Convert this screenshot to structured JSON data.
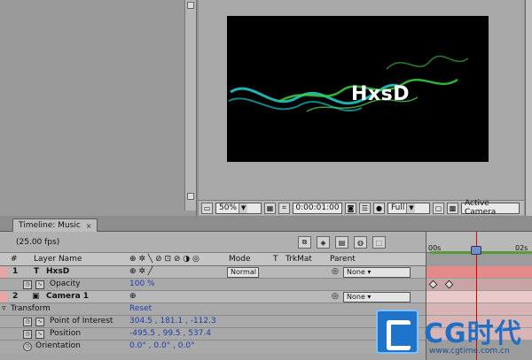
{
  "composition": {
    "text": "HxsD",
    "zoom": "50%",
    "timecode": "0:00:01:00",
    "resolution": "Full",
    "camera": "Active Camera"
  },
  "timeline": {
    "tab_label": "Timeline: Music",
    "tab_close": "×",
    "fps": "(25.00 fps)",
    "columns": {
      "num": "#",
      "layer_name": "Layer Name",
      "mode": "Mode",
      "t": "T",
      "trkmat": "TrkMat",
      "parent": "Parent"
    },
    "rows": [
      {
        "num": "1",
        "type_icon": "T",
        "name": "HxsD",
        "mode": "Normal",
        "parent": "None"
      },
      {
        "prop": "Opacity",
        "value": "100 %"
      },
      {
        "num": "2",
        "name": "Camera 1",
        "parent": "None"
      },
      {
        "section": "Transform",
        "value": "Reset"
      },
      {
        "prop": "Point of Interest",
        "value": "304.5 , 181.1 , -112.3"
      },
      {
        "prop": "Position",
        "value": "-495.5 , 99.5 , 537.4"
      },
      {
        "prop": "Orientation",
        "value": "0.0° , 0.0° , 0.0°"
      }
    ],
    "ruler": {
      "start": "00s",
      "end": "02s"
    }
  },
  "watermark": {
    "brand": "CG时代",
    "url": "www.cgtime.com.cn"
  },
  "colors": {
    "layer1_label": "#e9a5a5",
    "layer2_label": "#e9a5a5",
    "bar_layer1": "#e58a8a",
    "bar_layer2": "#e8c8c8",
    "value_blue": "#1a3fb0",
    "cti": "#d10000"
  }
}
